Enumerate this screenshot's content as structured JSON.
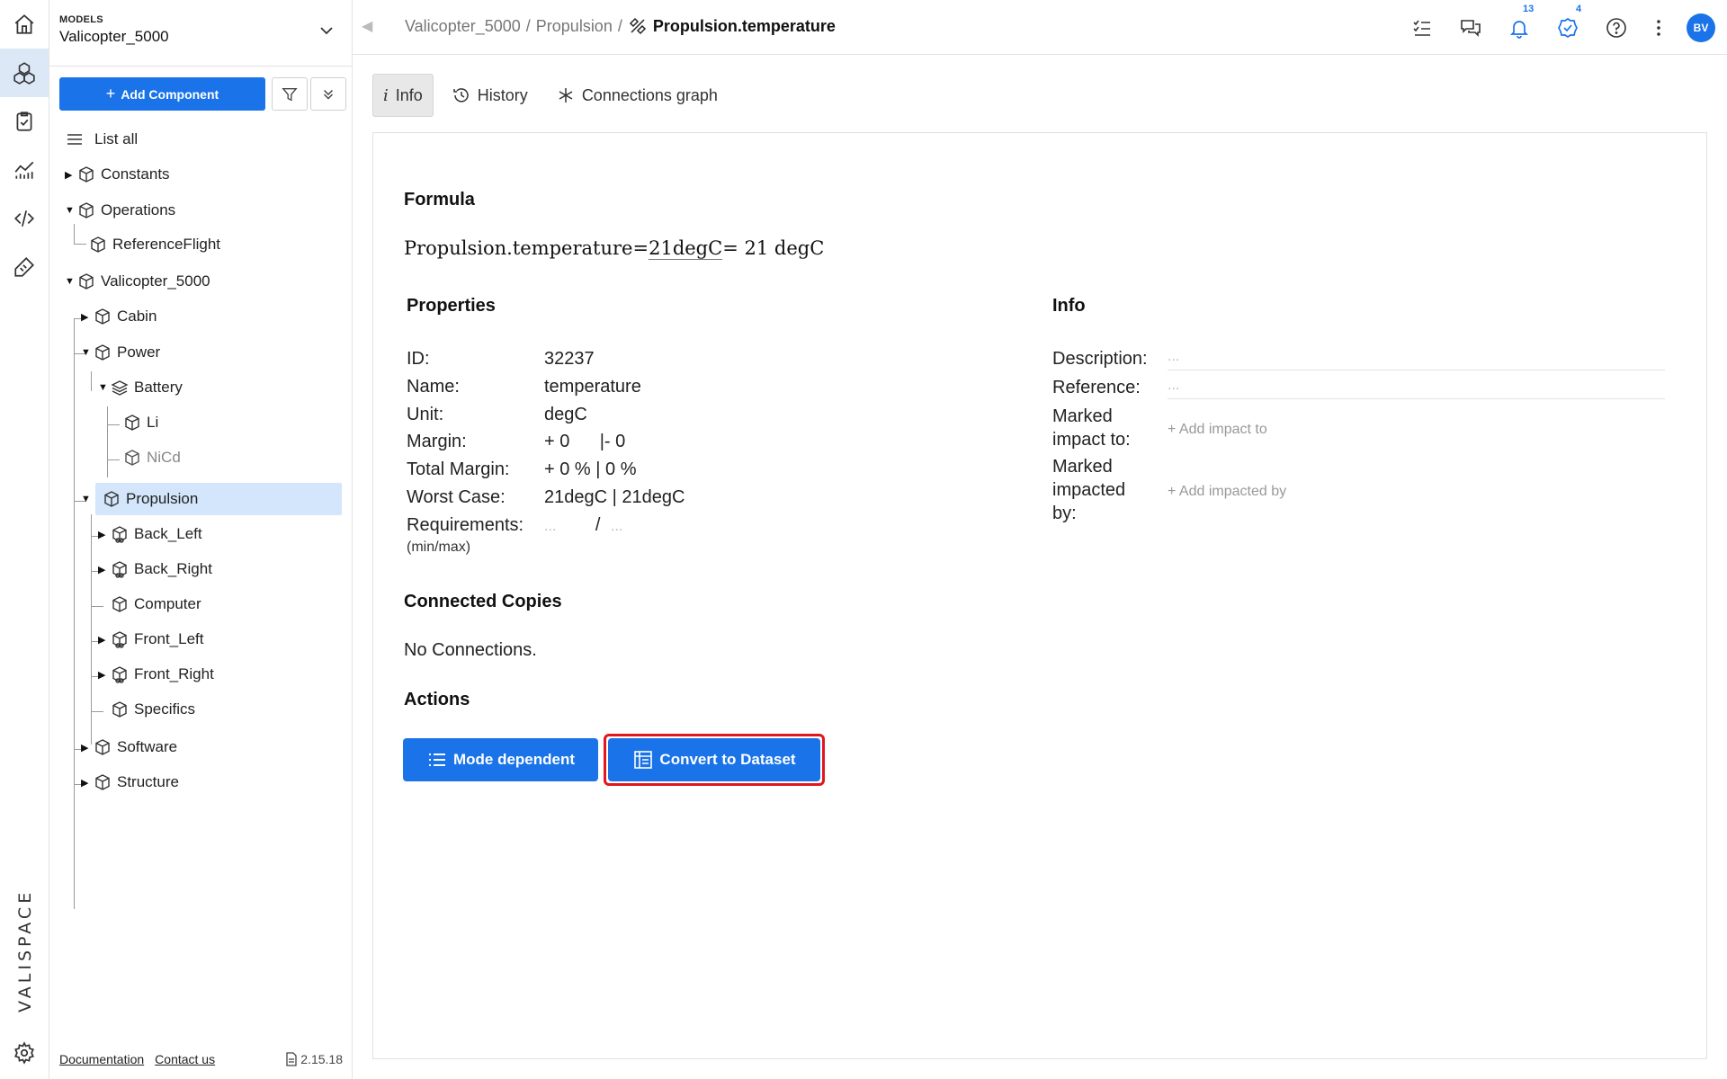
{
  "sidebar_header": {
    "kicker": "MODELS",
    "model_name": "Valicopter_5000"
  },
  "toolbar": {
    "add_label": "Add Component"
  },
  "tree": {
    "list_all": "List all",
    "constants": "Constants",
    "operations": "Operations",
    "reference_flight": "ReferenceFlight",
    "valicopter": "Valicopter_5000",
    "cabin": "Cabin",
    "power": "Power",
    "battery": "Battery",
    "li": "Li",
    "nicd": "NiCd",
    "propulsion": "Propulsion",
    "back_left": "Back_Left",
    "back_right": "Back_Right",
    "computer": "Computer",
    "front_left": "Front_Left",
    "front_right": "Front_Right",
    "specifics": "Specifics",
    "software": "Software",
    "structure": "Structure"
  },
  "footer": {
    "documentation": "Documentation",
    "contact": "Contact us",
    "version": "2.15.18"
  },
  "breadcrumb": {
    "root": "Valicopter_5000",
    "sep1": "/",
    "parent": "Propulsion",
    "sep2": "/",
    "current": "Propulsion.temperature"
  },
  "header_badges": {
    "notifications": "13",
    "tasks": "4"
  },
  "avatar": "BV",
  "brand": "VALISPACE",
  "tabs": {
    "info": "Info",
    "history": "History",
    "graph": "Connections graph"
  },
  "formula": {
    "heading": "Formula",
    "lhs": "Propulsion.temperature",
    "eq1": "=",
    "expr": "21degC",
    "eq2": "=",
    "result": " 21 degC"
  },
  "properties": {
    "heading": "Properties",
    "id_label": "ID:",
    "id": "32237",
    "name_label": "Name:",
    "name": "temperature",
    "unit_label": "Unit:",
    "unit": "degC",
    "margin_label": "Margin:",
    "margin": "+ 0      |- 0",
    "total_margin_label": "Total Margin:",
    "total_margin": "+ 0 % | 0 %",
    "worst_case_label": "Worst Case:",
    "worst_case": "21degC | 21degC",
    "requirements_label": "Requirements:",
    "req_min": "...",
    "req_sep": "/",
    "req_max": "...",
    "requirements_sub": "(min/max)"
  },
  "info": {
    "heading": "Info",
    "description_label": "Description:",
    "description": "...",
    "reference_label": "Reference:",
    "reference": "...",
    "impact_to_label_1": "Marked",
    "impact_to_label_2": "impact to:",
    "impact_to_link": "+ Add impact to",
    "impacted_label_1": "Marked",
    "impacted_label_2": "impacted",
    "impacted_label_3": "by:",
    "impacted_link": "+ Add impacted by"
  },
  "connected": {
    "heading": "Connected Copies",
    "empty": "No Connections."
  },
  "actions": {
    "heading": "Actions",
    "mode_dependent": "Mode dependent",
    "convert": "Convert to Dataset"
  },
  "colors": {
    "primary": "#1a73e8",
    "selected_row": "#d3e6fb",
    "highlight": "#e3161d"
  }
}
